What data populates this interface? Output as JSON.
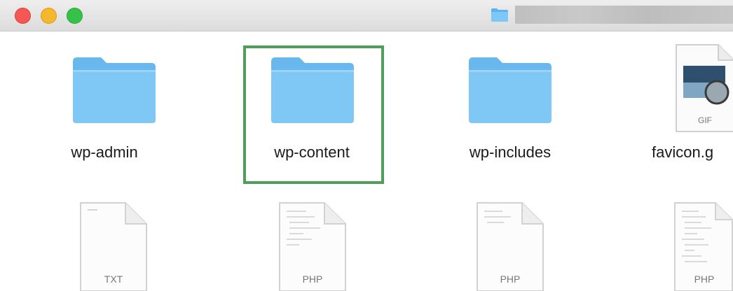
{
  "titlebar": {
    "traffic_lights": {
      "close": "#f45852",
      "minimize": "#f5b72e",
      "maximize": "#36c24a"
    },
    "path_icon": "folder-icon",
    "path_text_redacted": true
  },
  "accent": {
    "selection_border": "#4f9f5a",
    "folder_blue": "#7cc4f5"
  },
  "items": [
    {
      "name": "wp-admin",
      "kind": "folder",
      "selected": false
    },
    {
      "name": "wp-content",
      "kind": "folder",
      "selected": true
    },
    {
      "name": "wp-includes",
      "kind": "folder",
      "selected": false
    },
    {
      "name": "favicon.g",
      "kind": "file",
      "type_label": "GIF"
    }
  ],
  "files_row2": [
    {
      "type_label": "TXT"
    },
    {
      "type_label": "PHP"
    },
    {
      "type_label": "PHP"
    },
    {
      "type_label": "PHP"
    }
  ]
}
